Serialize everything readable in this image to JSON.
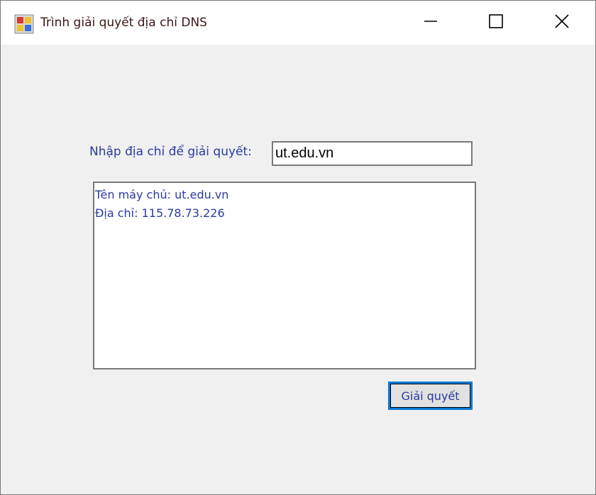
{
  "window": {
    "title": "Trình giải quyết địa chỉ DNS",
    "icon": "app-window-icon",
    "controls": {
      "minimize_icon": "minimize-icon",
      "maximize_icon": "maximize-icon",
      "close_icon": "close-icon"
    }
  },
  "form": {
    "prompt_label": "Nhập địa chỉ để giải quyết:",
    "address_value": "ut.edu.vn",
    "results": [
      "Tên máy chủ: ut.edu.vn",
      "Địa chỉ: 115.78.73.226"
    ],
    "resolve_button_label": "Giải quyết"
  },
  "colors": {
    "label_text": "#2b3aa0",
    "button_focus_border": "#0078d7",
    "client_background": "#f0f0f0"
  }
}
